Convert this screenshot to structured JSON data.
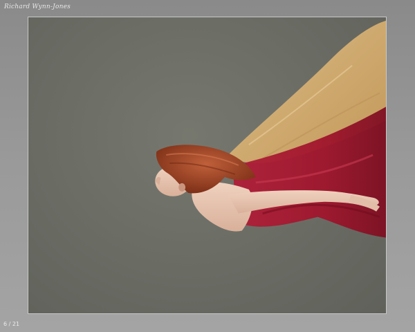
{
  "gallery": {
    "title": "Richard Wynn-Jones"
  },
  "photo": {
    "colors": {
      "background": "#6c6e66",
      "gold_fabric": "#d8b47a",
      "red_fabric": "#a8172f",
      "hair": "#a64a2a",
      "skin": "#e6c6b2"
    }
  },
  "navigation": {
    "counter": "6 / 21"
  }
}
